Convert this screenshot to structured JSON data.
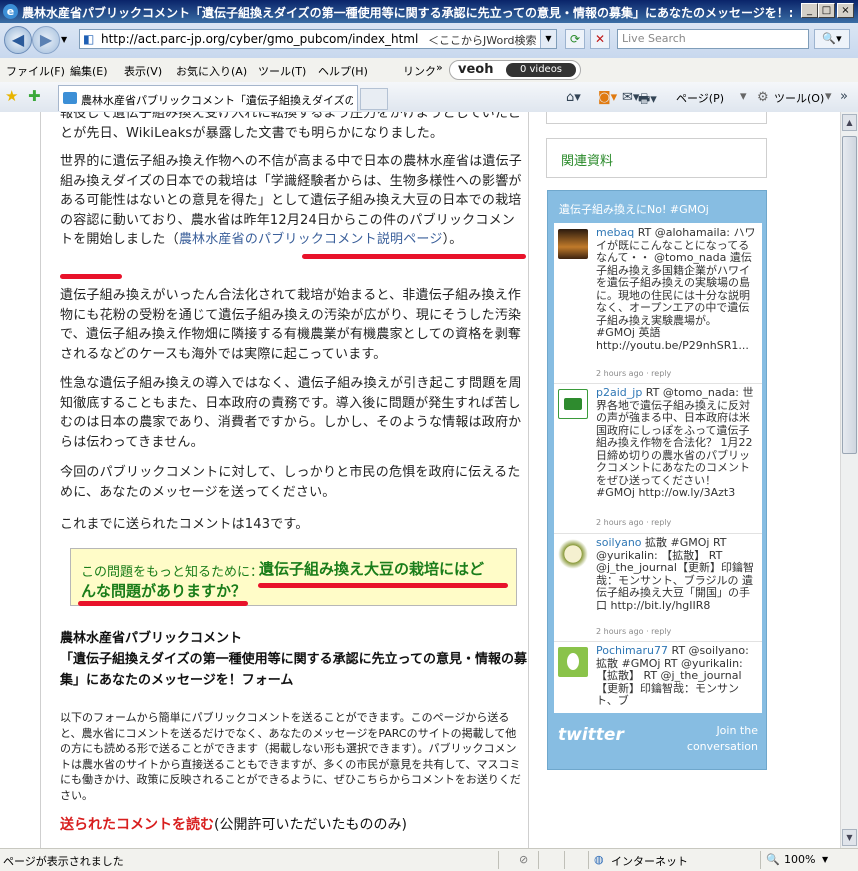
{
  "window": {
    "title": "農林水産省パブリックコメント「遺伝子組換えダイズの第一種使用等に関する承認に先立っての意見・情報の募集」にあなたのメッセージを！::PARC NPO..."
  },
  "address_bar": {
    "url": "http://act.parc-jp.org/cyber/gmo_pubcom/index_html",
    "jword_text": "＜ここからJWord検索",
    "search_placeholder": "Live Search"
  },
  "menu": [
    "ファイル(F)",
    "編集(E)",
    "表示(V)",
    "お気に入り(A)",
    "ツール(T)",
    "ヘルプ(H)"
  ],
  "links_label": "リンク",
  "veoh": {
    "logo": "veoh",
    "videos": "0 videos"
  },
  "tab": {
    "label": "農林水産省パブリックコメント「遺伝子組換えダイズの第..."
  },
  "toolbar_right": {
    "page": "ページ(P)",
    "tools": "ツール(O)"
  },
  "article": {
    "p0": "報役して遺伝子組み換え受け入れに転換するよう圧力をかけようとしていたことが先日、WikiLeaksが暴露した文書でも明らかになりました。",
    "p1a": "世界的に遺伝子組み換え作物への不信が高まる中で日本の農林水産省は遺伝子組み換えダイズの日本での栽培は「学識経験者からは、生物多様性への影響がある可能性はないとの意見を得た」として遺伝子組み換え大豆の日本での栽培の容認に動いており、農水省は昨年12月24日からこの件のパブリックコメントを開始しました（",
    "p1link": "農林水産省のパブリックコメント説明ページ",
    "p1b": "）。",
    "p2": "遺伝子組み換えがいったん合法化されて栽培が始まると、非遺伝子組み換え作物にも花粉の受粉を通じて遺伝子組み換えの汚染が広がり、現にそうした汚染で、遺伝子組み換え作物畑に隣接する有機農業が有機農家としての資格を剥奪されるなどのケースも海外では実際に起こっています。",
    "p3": "性急な遺伝子組み換えの導入ではなく、遺伝子組み換えが引き起こす問題を周知徹底することもまた、日本政府の責務です。導入後に問題が発生すれば苦しむのは日本の農家であり、消費者ですから。しかし、そのような情報は政府からは伝わってきません。",
    "p4": "今回のパブリックコメントに対して、しっかりと市民の危惧を政府に伝えるために、あなたのメッセージを送ってください。",
    "p5": "これまでに送られたコメントは143です。",
    "callout_lead": "この問題をもっと知るために：",
    "callout_link1": "遺伝子組み換え大豆の栽培にはど",
    "callout_link2": "んな問題がありますか？",
    "form_title1": "農林水産省パブリックコメント",
    "form_title2": "「遺伝子組換えダイズの第一種使用等に関する承認に先立っての意見・情報の募集」にあなたのメッセージを！フォーム",
    "form_desc": "以下のフォームから簡単にパブリックコメントを送ることができます。このページから送ると、農水省にコメントを送るだけでなく、あなたのメッセージをPARCのサイトの掲載して他の方にも読める形で送ることができます（掲載しない形も選択できます）。パブリックコメントは農水省のサイトから直接送ることもできますが、多くの市民が意見を共有して、マスコミにも働きかけ、政策に反映されることができるように、ぜひこちらからコメントをお送りください。",
    "read_link": "送られたコメントを読む",
    "read_note": "(公開許可いただいたもののみ)"
  },
  "sidebar": {
    "related": "関連資料",
    "widget_title": "遺伝子組み換えにNo! #GMOj",
    "tweets": [
      {
        "user": "mebaq",
        "text": " RT @alohamaila: ハワイが既にこんなことになってるなんて・・ @tomo_nada 遺伝子組み換え多国籍企業がハワイを遺伝子組み換えの実験場の島に。現地の住民には十分な説明なく、オープンエアの中で遺伝子組み換え実験農場が。 #GMOj 英語 http://youtu.be/P29nhSR1...",
        "meta": "2 hours ago · reply"
      },
      {
        "user": "p2aid_jp",
        "text": " RT @tomo_nada: 世界各地で遺伝子組み換えに反対の声が強まる中、日本政府は米国政府にしっぽをふって遺伝子組み換え作物を合法化？ 1月22日締め切りの農水省のパブリックコメントにあなたのコメントをぜひ送ってください！ #GMOj http://ow.ly/3Azt3",
        "meta": "2 hours ago · reply"
      },
      {
        "user": "soilyano",
        "text": " 拡散 #GMOj RT @yurikalin: 【拡散】 RT @j_the_journal【更新】印鑰智哉：モンサント、ブラジルの 遺伝子組み換え大豆「開国」の手口 http://bit.ly/hgIIR8",
        "meta": "2 hours ago · reply"
      },
      {
        "user": "Pochimaru77",
        "text": " RT @soilyano: 拡散 #GMOj RT @yurikalin: 【拡散】 RT @j_the_journal 【更新】印鑰智哉：モンサント、ブ",
        "meta": ""
      }
    ],
    "twitter_logo": "twitter",
    "join1": "Join the",
    "join2": "conversation"
  },
  "status": {
    "text": "ページが表示されました",
    "zone": "インターネット",
    "zoom": "100%"
  }
}
